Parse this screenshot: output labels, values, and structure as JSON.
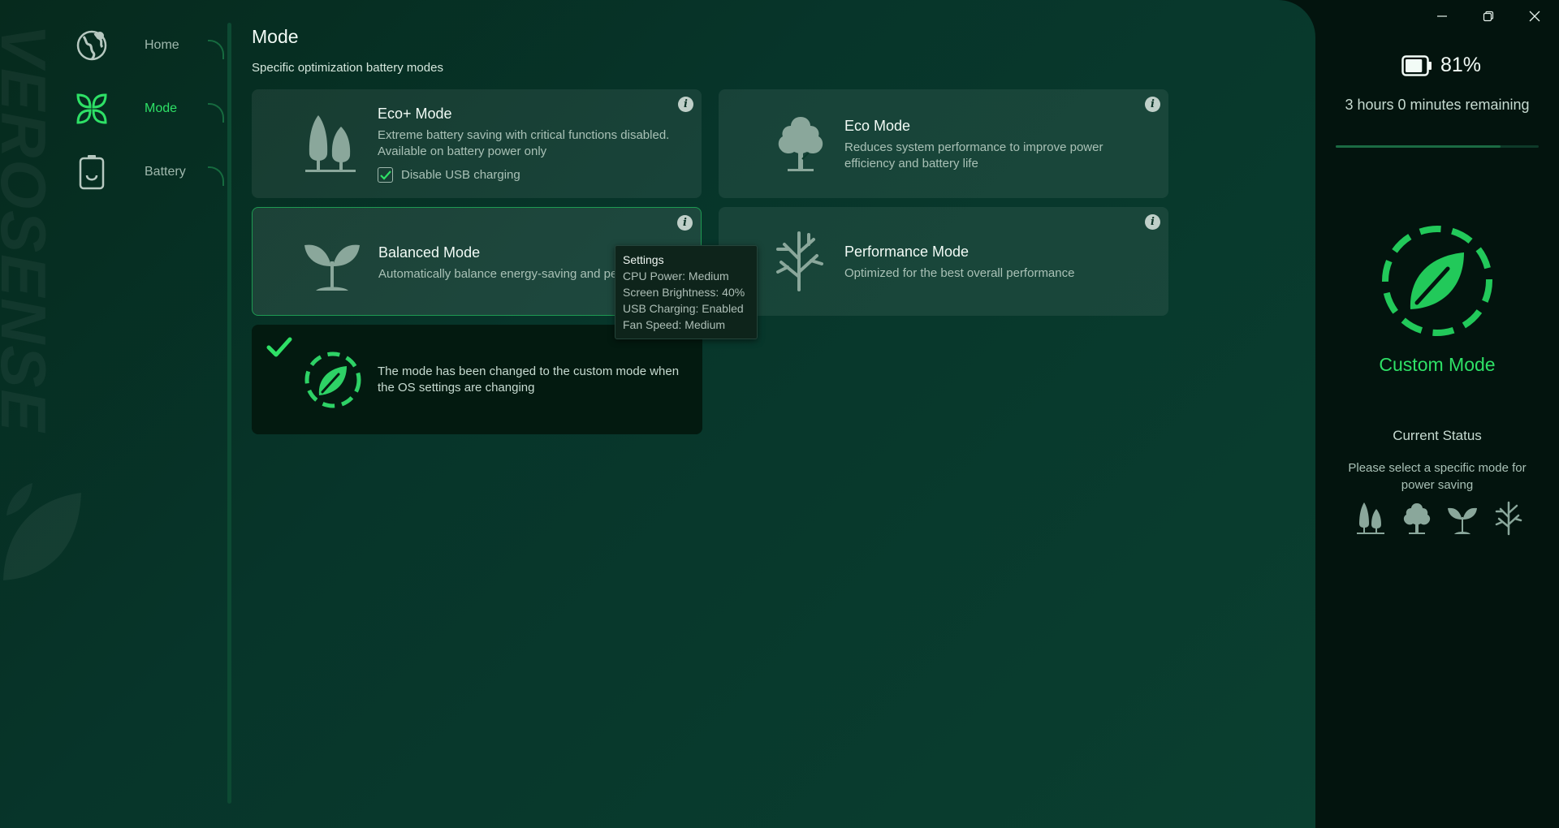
{
  "app": {
    "brand_watermark": "VEROSENSE"
  },
  "nav": {
    "items": [
      {
        "id": "home",
        "label": "Home"
      },
      {
        "id": "mode",
        "label": "Mode"
      },
      {
        "id": "battery",
        "label": "Battery"
      }
    ],
    "active": "mode"
  },
  "page": {
    "title": "Mode",
    "subtitle": "Specific optimization battery modes"
  },
  "modes": [
    {
      "title": "Eco+ Mode",
      "desc": "Extreme battery saving with critical functions disabled. Available on battery power only",
      "checkbox_label": "Disable USB charging",
      "checkbox_checked": true
    },
    {
      "title": "Eco Mode",
      "desc": "Reduces system performance to improve power efficiency and battery life"
    },
    {
      "title": "Balanced Mode",
      "desc": "Automatically balance energy-saving and pe"
    },
    {
      "title": "Performance Mode",
      "desc": "Optimized for the best overall performance"
    }
  ],
  "info_icon_glyph": "i",
  "custom_card": {
    "message": "The mode has been changed to the custom mode when the OS settings are changing"
  },
  "tooltip": {
    "title": "Settings",
    "lines": [
      "CPU Power: Medium",
      "Screen Brightness: 40%",
      "USB Charging: Enabled",
      "Fan Speed: Medium"
    ]
  },
  "status_panel": {
    "battery_percent": "81%",
    "battery_level": 0.81,
    "remaining": "3 hours 0 minutes remaining",
    "current_mode": "Custom Mode",
    "status_title": "Current Status",
    "status_desc": "Please select a specific mode for power saving"
  },
  "colors": {
    "accent": "#2ee066",
    "panel_bg": "#07352a",
    "dark_bg": "#03140e",
    "icon_gray": "#8aa79b"
  },
  "icons": {
    "home": "globe-icon",
    "mode": "leaves-icon",
    "battery": "battery-icon",
    "eco_plus": "two-trees-icon",
    "eco": "tree-icon",
    "balanced": "sprout-icon",
    "performance": "branch-icon",
    "custom": "dashed-leaf-icon"
  }
}
